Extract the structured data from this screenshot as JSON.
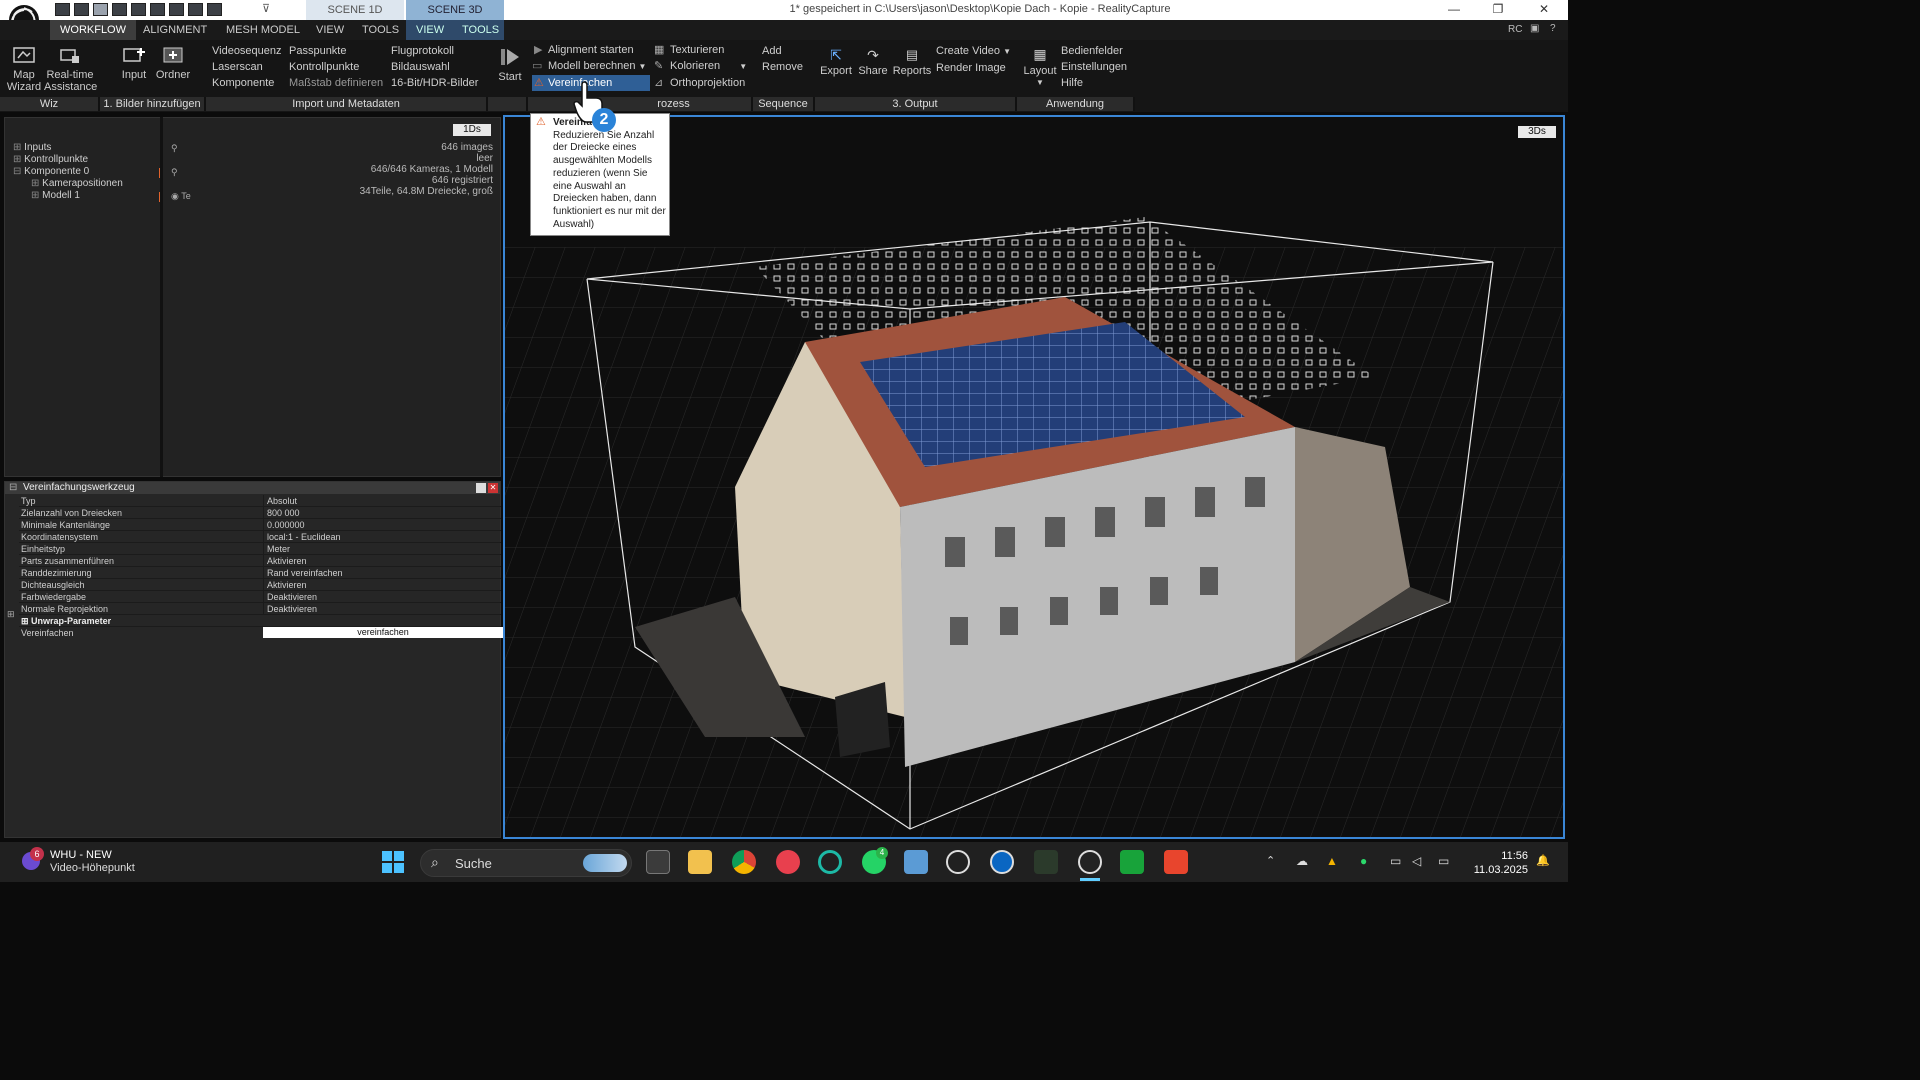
{
  "titlebar": {
    "scene_1d": "SCENE 1D",
    "scene_3d": "SCENE 3D",
    "title": "1* gespeichert in C:\\Users\\jason\\Desktop\\Kopie Dach - Kopie - RealityCapture",
    "minimize": "—",
    "restore": "❐",
    "close": "✕"
  },
  "menubar": {
    "items": [
      "WORKFLOW",
      "ALIGNMENT",
      "MESH MODEL",
      "VIEW",
      "TOOLS"
    ],
    "scene_items": [
      "VIEW",
      "TOOLS"
    ],
    "rc": "RC"
  },
  "ribbon": {
    "map_wizard": [
      "Map",
      "Wizard"
    ],
    "realtime": [
      "Real-time",
      "Assistance"
    ],
    "input": "Input",
    "ordner": "Ordner",
    "col1": [
      "Videosequenz",
      "Laserscan",
      "Komponente"
    ],
    "col2": [
      "Passpunkte",
      "Kontrollpunkte",
      "Maßstab definieren"
    ],
    "col3": [
      "Flugprotokoll",
      "Bildauswahl",
      "16-Bit/HDR-Bilder"
    ],
    "start": "Start",
    "process_col1": [
      "Alignment starten",
      "Modell berechnen",
      "Vereinfachen"
    ],
    "process_col2": [
      "Texturieren",
      "Kolorieren",
      "Orthoprojektion"
    ],
    "sequence": [
      "Add",
      "Remove"
    ],
    "export": "Export",
    "share": "Share",
    "reports": "Reports",
    "output_col": [
      "Create Video",
      "Render Image"
    ],
    "layout": "Layout",
    "app_col": [
      "Bedienfelder",
      "Einstellungen",
      "Hilfe"
    ],
    "groups": [
      "Wiz",
      "1. Bilder hinzufügen",
      "Import und Metadaten",
      "",
      "rozess",
      "Sequence",
      "3. Output",
      "Anwendung"
    ]
  },
  "tree": {
    "badge": "1Ds",
    "rows": [
      {
        "label": "Inputs",
        "value": "646 images"
      },
      {
        "label": "Kontrollpunkte",
        "value": "leer"
      },
      {
        "label": "Komponente 0",
        "value": "646/646 Kameras, 1 Modell"
      },
      {
        "label": "",
        "value": "646 registriert"
      },
      {
        "label": "Kamerapositionen",
        "value": ""
      },
      {
        "label": "Modell 1",
        "value": "34Teile, 64.8M Dreiecke, groß"
      }
    ]
  },
  "tool": {
    "title": "Vereinfachungswerkzeug",
    "props": [
      {
        "k": "Typ",
        "v": "Absolut"
      },
      {
        "k": "Zielanzahl von Dreiecken",
        "v": "800 000"
      },
      {
        "k": "Minimale Kantenlänge",
        "v": "0.000000"
      },
      {
        "k": "Koordinatensystem",
        "v": "local:1 - Euclidean"
      },
      {
        "k": "Einheitstyp",
        "v": "Meter"
      },
      {
        "k": "Parts zusammenführen",
        "v": "Aktivieren"
      },
      {
        "k": "Randdezimierung",
        "v": "Rand vereinfachen"
      },
      {
        "k": "Dichteausgleich",
        "v": "Aktivieren"
      },
      {
        "k": "Farbwiedergabe",
        "v": "Deaktivieren"
      },
      {
        "k": "Normale Reprojektion",
        "v": "Deaktivieren"
      }
    ],
    "unwrap": "Unwrap-Parameter",
    "simplify_label": "Vereinfachen",
    "simplify_button": "vereinfachen"
  },
  "view3d": {
    "badge": "3Ds"
  },
  "tooltip": {
    "title": "Vereinfachen",
    "body": "Reduzieren Sie Anzahl der Dreiecke eines ausgewählten Modells reduzieren (wenn Sie eine Auswahl an Dreiecken haben, dann funktioniert es nur mit der Auswahl)",
    "step": "2"
  },
  "taskbar": {
    "notification_count": "6",
    "app_title": "WHU - NEW",
    "app_subtitle": "Video-Höhepunkt",
    "search": "Suche",
    "whatsapp_badge": "4",
    "time": "11:56",
    "date": "11.03.2025"
  },
  "colors": {
    "accent": "#3a86d6",
    "warning": "#e0632c"
  }
}
